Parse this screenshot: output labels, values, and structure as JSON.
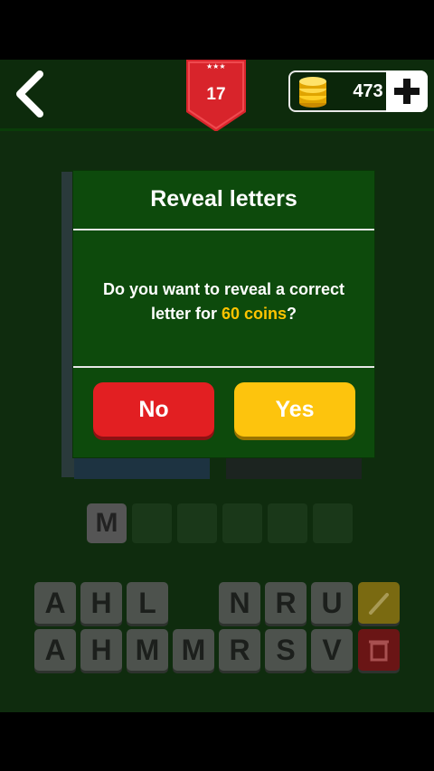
{
  "header": {
    "level": "17",
    "coins": "473"
  },
  "answer": {
    "revealed_letter": "M"
  },
  "keyboard": {
    "row1": [
      "A",
      "H",
      "L",
      "",
      "N",
      "R",
      "U"
    ],
    "row2": [
      "A",
      "H",
      "M",
      "M",
      "R",
      "S",
      "V"
    ]
  },
  "dialog": {
    "title": "Reveal letters",
    "message_prefix": "Do you want to reveal a correct letter for ",
    "message_highlight": "60 coins",
    "message_suffix": "?",
    "no_label": "No",
    "yes_label": "Yes"
  },
  "colors": {
    "accent_red": "#e21f22",
    "accent_yellow": "#fdc40d",
    "dialog_green": "#0d4a0c"
  },
  "icons": {
    "back": "chevron-left-icon",
    "coins": "coin-stack-icon",
    "add": "plus-icon",
    "hint": "magic-wand-icon",
    "delete": "trash-icon"
  }
}
